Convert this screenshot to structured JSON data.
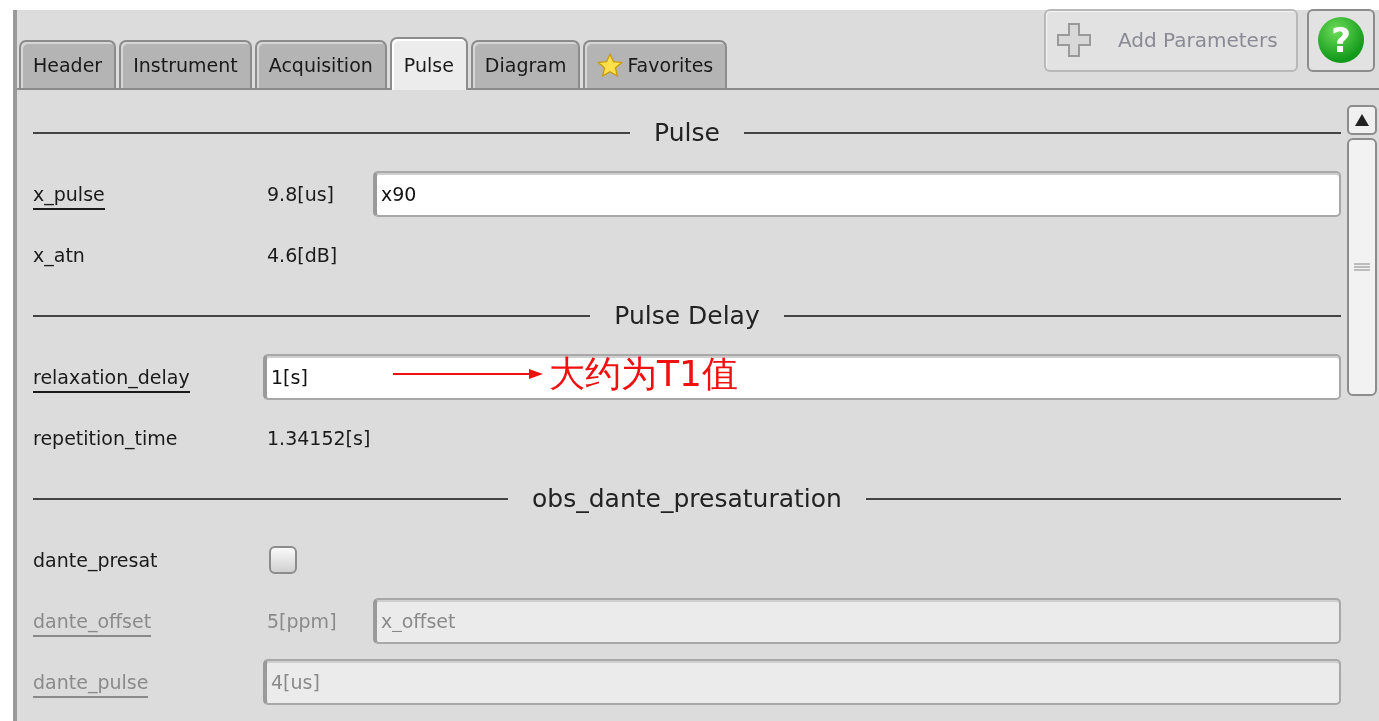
{
  "tabs": [
    {
      "label": "Header",
      "selected": false
    },
    {
      "label": "Instrument",
      "selected": false
    },
    {
      "label": "Acquisition",
      "selected": false
    },
    {
      "label": "Pulse",
      "selected": true
    },
    {
      "label": "Diagram",
      "selected": false
    },
    {
      "label": "Favorites",
      "selected": false,
      "starred": true
    }
  ],
  "add_parameters": {
    "label": "Add Parameters",
    "disabled": true
  },
  "help_button": {
    "label": "?"
  },
  "sections": [
    {
      "title": "Pulse",
      "rows": [
        {
          "kind": "field",
          "label": "x_pulse",
          "linked": true,
          "disabled": false,
          "reading": "9.8[us]",
          "value": "x90"
        },
        {
          "kind": "value",
          "label": "x_atn",
          "linked": false,
          "disabled": false,
          "reading": "4.6[dB]"
        }
      ]
    },
    {
      "title": "Pulse Delay",
      "rows": [
        {
          "kind": "field",
          "label": "relaxation_delay",
          "linked": true,
          "disabled": false,
          "value": "1[s]",
          "annotation": "大约为T1值"
        },
        {
          "kind": "value",
          "label": "repetition_time",
          "linked": false,
          "disabled": false,
          "reading": "1.34152[s]"
        }
      ]
    },
    {
      "title": "obs_dante_presaturation",
      "rows": [
        {
          "kind": "checkbox",
          "label": "dante_presat",
          "linked": false,
          "disabled": false,
          "checked": false
        },
        {
          "kind": "field",
          "label": "dante_offset",
          "linked": true,
          "disabled": true,
          "reading": "5[ppm]",
          "value": "x_offset"
        },
        {
          "kind": "field",
          "label": "dante_pulse",
          "linked": true,
          "disabled": true,
          "value": "4[us]"
        }
      ]
    }
  ]
}
